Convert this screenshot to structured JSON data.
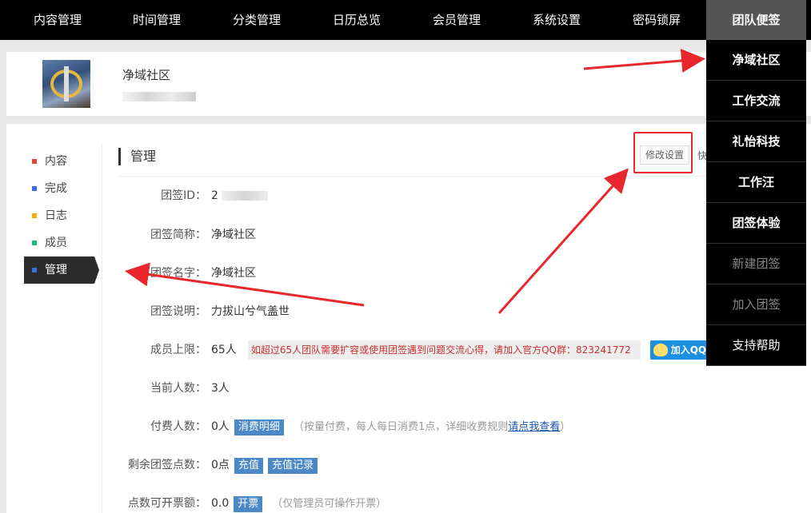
{
  "topnav": {
    "items": [
      {
        "label": "内容管理"
      },
      {
        "label": "时间管理"
      },
      {
        "label": "分类管理"
      },
      {
        "label": "日历总览"
      },
      {
        "label": "会员管理"
      },
      {
        "label": "系统设置"
      },
      {
        "label": "密码锁屏"
      },
      {
        "label": "团队便签"
      }
    ]
  },
  "dropdown": {
    "items": [
      {
        "label": "净域社区"
      },
      {
        "label": "工作交流"
      },
      {
        "label": "礼怡科技"
      },
      {
        "label": "工作汪"
      },
      {
        "label": "团签体验"
      },
      {
        "label": "新建团签"
      },
      {
        "label": "加入团签"
      },
      {
        "label": "支持帮助"
      }
    ]
  },
  "header": {
    "team_name": "净域社区",
    "logo_icon": "team-logo"
  },
  "sidebar": {
    "items": [
      {
        "label": "内容",
        "color": "#e64340"
      },
      {
        "label": "完成",
        "color": "#3b6fe0"
      },
      {
        "label": "日志",
        "color": "#f0b400"
      },
      {
        "label": "成员",
        "color": "#1ebc72"
      },
      {
        "label": "管理",
        "color": "#3b6fe0"
      }
    ]
  },
  "section": {
    "title": "管理",
    "edit_button": "修改设置",
    "quick_button": "快"
  },
  "fields": {
    "id_label": "团签ID：",
    "id_value": "2",
    "short_label": "团签简称：",
    "short_value": "净域社区",
    "name_label": "团签名字：",
    "name_value": "净域社区",
    "desc_label": "团签说明：",
    "desc_value": "力拔山兮气盖世",
    "limit_label": "成员上限：",
    "limit_value": "65人",
    "limit_notice": "如超过65人团队需要扩容或使用团签遇到问题交流心得，请加入官方QQ群：823241772",
    "qq_button": "加入QQ群",
    "current_label": "当前人数：",
    "current_value": "3人",
    "paid_label": "付费人数：",
    "paid_value": "0人",
    "paid_tag": "消费明细",
    "paid_note": "（按量付费，每人每日消费1点，详细收费规则",
    "paid_link": "请点我查看",
    "paid_note_end": "）",
    "points_label": "剩余团签点数：",
    "points_value": "0点",
    "recharge_tag": "充值",
    "recharge_log_tag": "充值记录",
    "invoice_label": "点数可开票额：",
    "invoice_value": "0.0",
    "invoice_tag": "开票",
    "invoice_note": "（仅管理员可操作开票）"
  },
  "colors": {
    "nav_bg": "#000000",
    "active_nav_bg": "#555555",
    "annotation_red": "#e8262b",
    "tag_blue": "#4a88c7"
  }
}
